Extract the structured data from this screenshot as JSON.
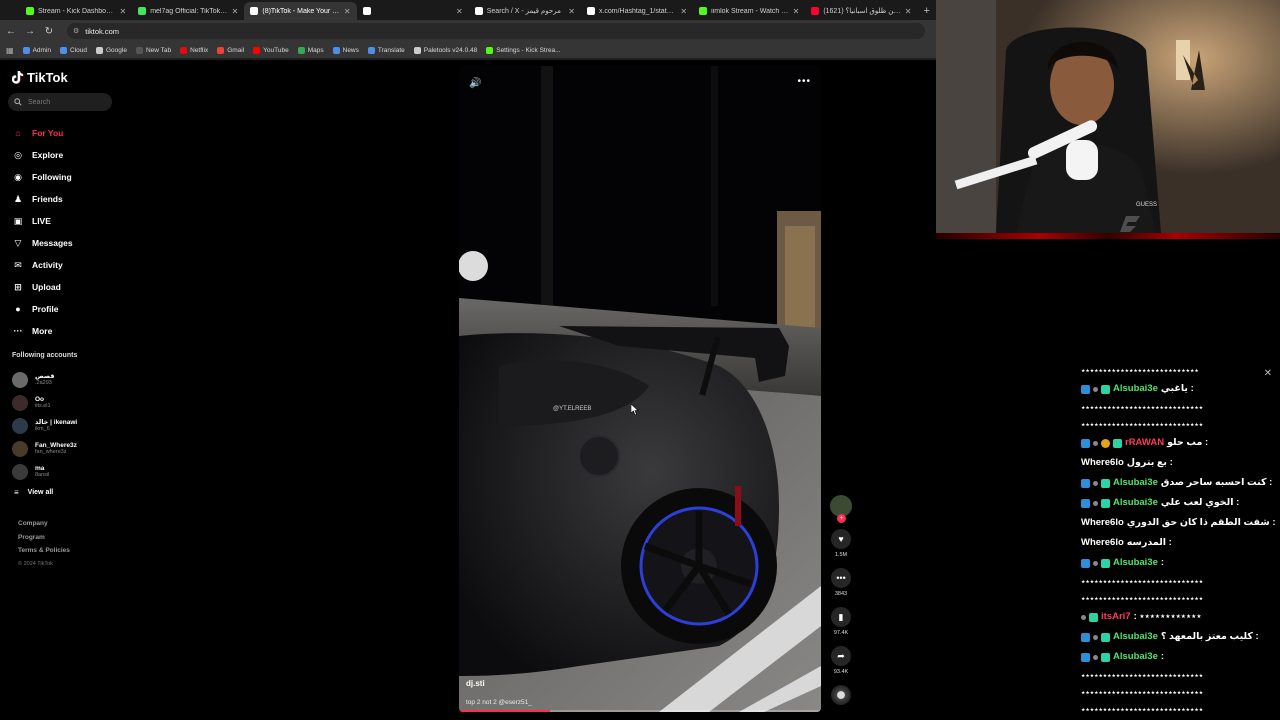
{
  "browser": {
    "tabs": [
      {
        "title": "Stream - Kick Dashboard",
        "color": "#53fc18",
        "active": false
      },
      {
        "title": "mel7ag Official: TikTok | Linktr",
        "color": "#43e55e",
        "active": false
      },
      {
        "title": "(8)TikTok - Make Your Day",
        "color": "#ffffff",
        "active": true
      },
      {
        "title": "",
        "color": "#ffffff",
        "active": false
      },
      {
        "title": "Search / X - مرحوم قيمز",
        "color": "#ffffff",
        "active": false
      },
      {
        "title": "x.com/Hashtag_1/status/206",
        "color": "#ffffff",
        "active": false
      },
      {
        "title": "iimlok Stream - Watch Live on",
        "color": "#53fc18",
        "active": false
      },
      {
        "title": "(1621) وين ظلوق اسبانيا؟ es الل...",
        "color": "#ff0033",
        "active": false
      }
    ],
    "new_tab": "+",
    "url": "tiktok.com",
    "bookmarks": [
      {
        "label": "Admin",
        "color": "#4d8fe8"
      },
      {
        "label": "Cloud",
        "color": "#4d8fe8"
      },
      {
        "label": "Google",
        "color": "#cccccc"
      },
      {
        "label": "New Tab",
        "color": "#555555"
      },
      {
        "label": "Netflix",
        "color": "#e50914"
      },
      {
        "label": "Gmail",
        "color": "#ea4335"
      },
      {
        "label": "YouTube",
        "color": "#ff0000"
      },
      {
        "label": "Maps",
        "color": "#34a853"
      },
      {
        "label": "News",
        "color": "#4d8fe8"
      },
      {
        "label": "Translate",
        "color": "#4d8fe8"
      },
      {
        "label": "Paletools v24.0.48",
        "color": "#cccccc"
      },
      {
        "label": "Settings - Kick Strea...",
        "color": "#53fc18"
      }
    ]
  },
  "tiktok": {
    "logo": "TikTok",
    "search_placeholder": "Search",
    "nav": [
      {
        "label": "For You",
        "icon": "home-icon",
        "active": true
      },
      {
        "label": "Explore",
        "icon": "compass-icon",
        "active": false
      },
      {
        "label": "Following",
        "icon": "following-icon",
        "active": false
      },
      {
        "label": "Friends",
        "icon": "friends-icon",
        "active": false
      },
      {
        "label": "LIVE",
        "icon": "live-icon",
        "active": false
      },
      {
        "label": "Messages",
        "icon": "messages-icon",
        "active": false
      },
      {
        "label": "Activity",
        "icon": "activity-icon",
        "active": false
      },
      {
        "label": "Upload",
        "icon": "upload-icon",
        "active": false
      },
      {
        "label": "Profile",
        "icon": "profile-icon",
        "active": false
      },
      {
        "label": "More",
        "icon": "more-icon",
        "active": false
      }
    ],
    "following_title": "Following accounts",
    "following": [
      {
        "name": "قصص",
        "handle": ".2a293"
      },
      {
        "name": "Oo",
        "handle": "iits.el1"
      },
      {
        "name": "خالد | ikenawi",
        "handle": "ikm_6"
      },
      {
        "name": "Fan_Where3z",
        "handle": "fan_where3z"
      },
      {
        "name": "ma",
        "handle": "8ansil"
      }
    ],
    "view_all": "View all",
    "footer": [
      "Company",
      "Program",
      "Terms & Policies"
    ],
    "copyright": "© 2024 TikTok",
    "video": {
      "author": "dj.sti",
      "caption": "top 2 not 2 @eserz51_",
      "watermark": "@YT.ELREEB",
      "progress": 0.25
    },
    "actions": {
      "likes": "1.5M",
      "comments": "3843",
      "saves": "97.4K",
      "shares": "93.4K"
    }
  },
  "chat": {
    "messages": [
      {
        "type": "spam",
        "text": "٭٭٭٭٭٭٭٭٭٭٭٭٭٭٭٭٭٭٭٭٭٭٭٭٭٭٭"
      },
      {
        "type": "msg",
        "user": "Alsubai3e",
        "color": "#54e36a",
        "badges": [
          "blue",
          "gray",
          "teal"
        ],
        "text": "ياغبي :"
      },
      {
        "type": "spam",
        "text": "٭٭٭٭٭٭٭٭٭٭٭٭٭٭٭٭٭٭٭٭٭٭٭٭٭٭٭٭"
      },
      {
        "type": "spam",
        "text": "٭٭٭٭٭٭٭٭٭٭٭٭٭٭٭٭٭٭٭٭٭٭٭٭٭٭٭٭"
      },
      {
        "type": "msg",
        "user": "rRAWAN",
        "color": "#ff3b5c",
        "badges": [
          "blue",
          "gray",
          "gold",
          "teal"
        ],
        "text": "مب حلو :"
      },
      {
        "type": "msg",
        "user": "Where6lo",
        "color": "#ffffff",
        "badges": [],
        "text": "بع بترول :"
      },
      {
        "type": "msg",
        "user": "Alsubai3e",
        "color": "#54e36a",
        "badges": [
          "blue",
          "gray",
          "teal"
        ],
        "text": "كنت احسبه ساحر صدق :"
      },
      {
        "type": "msg",
        "user": "Alsubai3e",
        "color": "#54e36a",
        "badges": [
          "blue",
          "gray",
          "teal"
        ],
        "text": "الخوي لعب علي :"
      },
      {
        "type": "msg",
        "user": "Where6lo",
        "color": "#ffffff",
        "badges": [],
        "text": "شفت الطقم ذا كان حق الدوري :"
      },
      {
        "type": "msg",
        "user": "Where6lo",
        "color": "#ffffff",
        "badges": [],
        "text": "المدرسه :"
      },
      {
        "type": "msg",
        "user": "Alsubai3e",
        "color": "#54e36a",
        "badges": [
          "blue",
          "gray",
          "teal"
        ],
        "text": ":"
      },
      {
        "type": "spam",
        "text": "٭٭٭٭٭٭٭٭٭٭٭٭٭٭٭٭٭٭٭٭٭٭٭٭٭٭٭٭"
      },
      {
        "type": "spam",
        "text": "٭٭٭٭٭٭٭٭٭٭٭٭٭٭٭٭٭٭٭٭٭٭٭٭٭٭٭٭"
      },
      {
        "type": "msg",
        "user": "itsAri7",
        "color": "#ff3b5c",
        "badges": [
          "gray",
          "teal"
        ],
        "text": ": ٭٭٭٭٭٭٭٭٭٭٭٭"
      },
      {
        "type": "msg",
        "user": "Alsubai3e",
        "color": "#54e36a",
        "badges": [
          "blue",
          "gray",
          "teal"
        ],
        "text": "كليب معتز بالمعهد ؟ :"
      },
      {
        "type": "msg",
        "user": "Alsubai3e",
        "color": "#54e36a",
        "badges": [
          "blue",
          "gray",
          "teal"
        ],
        "text": ":"
      },
      {
        "type": "spam",
        "text": "٭٭٭٭٭٭٭٭٭٭٭٭٭٭٭٭٭٭٭٭٭٭٭٭٭٭٭٭"
      },
      {
        "type": "spam",
        "text": "٭٭٭٭٭٭٭٭٭٭٭٭٭٭٭٭٭٭٭٭٭٭٭٭٭٭٭٭"
      },
      {
        "type": "spam",
        "text": "٭٭٭٭٭٭٭٭٭٭٭٭٭٭٭٭٭٭٭٭٭٭٭٭٭٭٭٭"
      }
    ]
  }
}
